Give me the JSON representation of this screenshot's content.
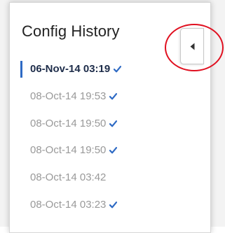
{
  "panel": {
    "title": "Config History"
  },
  "history": [
    {
      "label": "06-Nov-14 03:19",
      "active": true,
      "verified": true
    },
    {
      "label": "08-Oct-14 19:53",
      "active": false,
      "verified": true
    },
    {
      "label": "08-Oct-14 19:50",
      "active": false,
      "verified": true
    },
    {
      "label": "08-Oct-14 19:50",
      "active": false,
      "verified": true
    },
    {
      "label": "08-Oct-14 03:42",
      "active": false,
      "verified": false
    },
    {
      "label": "08-Oct-14 03:23",
      "active": false,
      "verified": true
    }
  ],
  "collapse_tab": {
    "icon": "caret-left-icon"
  },
  "colors": {
    "accent": "#2e6ac4",
    "check": "#2e6ac4",
    "active_text": "#1e2d4a",
    "inactive_text": "#999999",
    "highlight_ring": "#e01020"
  }
}
